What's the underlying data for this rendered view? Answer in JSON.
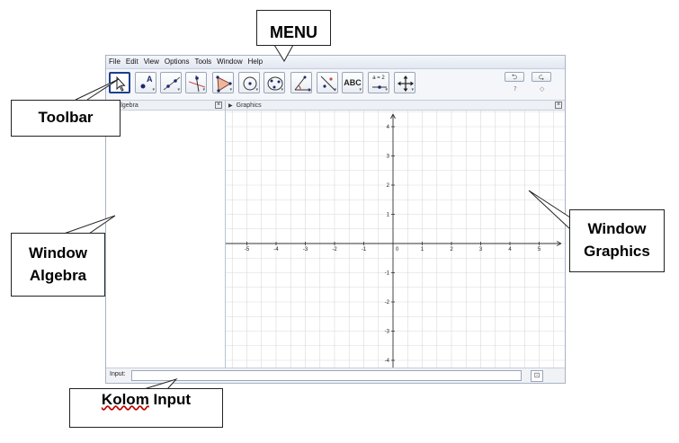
{
  "menu": {
    "items": [
      "File",
      "Edit",
      "View",
      "Options",
      "Tools",
      "Window",
      "Help"
    ]
  },
  "toolbar": {
    "tools": [
      {
        "name": "move-tool-icon",
        "label": ""
      },
      {
        "name": "point-tool-icon",
        "label": "A"
      },
      {
        "name": "line-tool-icon",
        "label": ""
      },
      {
        "name": "perpendicular-tool-icon",
        "label": ""
      },
      {
        "name": "polygon-tool-icon",
        "label": ""
      },
      {
        "name": "circle-tool-icon",
        "label": ""
      },
      {
        "name": "conic-tool-icon",
        "label": ""
      },
      {
        "name": "angle-tool-icon",
        "label": ""
      },
      {
        "name": "reflect-tool-icon",
        "label": ""
      },
      {
        "name": "text-tool-icon",
        "label": "ABC"
      },
      {
        "name": "slider-tool-icon",
        "label": "a = 2"
      },
      {
        "name": "move-graphics-tool-icon",
        "label": ""
      }
    ],
    "undo_symbol": "⮌",
    "redo_symbol": "⮎",
    "help_symbol": "?",
    "settings_symbol": "◇"
  },
  "algebra": {
    "title": "Algebra",
    "close_symbol": "×"
  },
  "graphics": {
    "title": "Graphics",
    "close_symbol": "×",
    "x_ticks": [
      -5,
      -4,
      -3,
      -2,
      -1,
      0,
      1,
      2,
      3,
      4,
      5
    ],
    "y_ticks": [
      -4,
      -3,
      -2,
      -1,
      1,
      2,
      3,
      4
    ]
  },
  "input_bar": {
    "label": "Input:",
    "value": "",
    "help_symbol": "⊡"
  },
  "callouts": {
    "menu": "MENU",
    "toolbar": "Toolbar",
    "window_algebra": [
      "Window",
      "Algebra"
    ],
    "window_graphics": [
      "Window",
      "Graphics"
    ],
    "kolom_input_underlined": "Kolom",
    "kolom_input_rest": " Input"
  },
  "colors": {
    "axis": "#333333",
    "grid": "#d9d9d9",
    "selected_tool_border": "#1d3f8f",
    "panel_bg": "#edf0f5"
  }
}
